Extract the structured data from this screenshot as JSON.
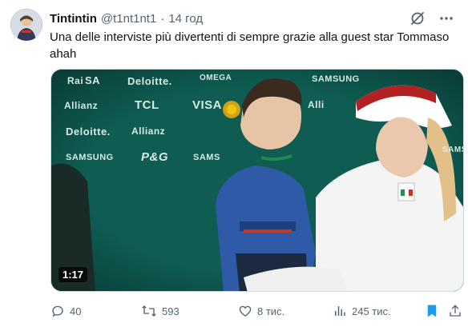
{
  "tweet": {
    "display_name": "Tintintin",
    "handle": "@t1nt1nt1",
    "separator": "·",
    "time": "14 год",
    "text": "Una delle interviste più divertenti di sempre grazie alla guest star Tommaso ahah"
  },
  "media": {
    "duration": "1:17",
    "sponsors": [
      "Deloitte.",
      "OMEGA",
      "SAMSUNG",
      "Allianz",
      "TCL",
      "VISA",
      "Alli",
      "Deloitte.",
      "Allianz",
      "SAMSUNG",
      "P&G",
      "SAMS",
      "SAMSUNG",
      "Rai",
      "SA"
    ],
    "overlay_text": "rai"
  },
  "actions": {
    "replies": "40",
    "reposts": "593",
    "likes": "8 тис.",
    "views": "245 тис."
  },
  "colors": {
    "accent": "#1d9bf0",
    "muted": "#536471",
    "media_bg": "#0d5a4f"
  }
}
